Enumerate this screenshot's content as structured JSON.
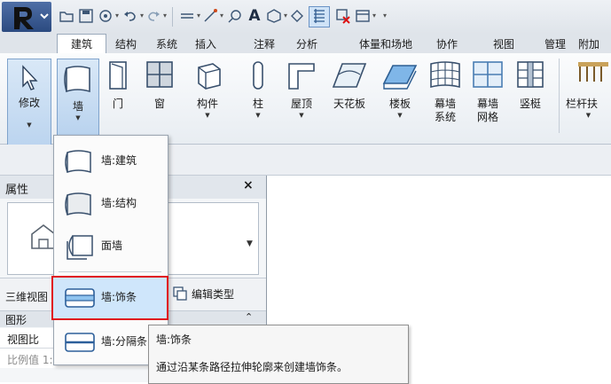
{
  "quick_access": {
    "icons": [
      "open-icon",
      "save-icon",
      "sync-icon",
      "undo-icon",
      "redo-icon",
      "measure-icon",
      "dimension-icon",
      "tag-icon",
      "text-icon",
      "view-3d-icon",
      "section-icon",
      "thin-lines-icon",
      "close-views-icon",
      "switch-windows-icon"
    ]
  },
  "tabs": [
    "建筑",
    "结构",
    "系统",
    "插入",
    "注释",
    "分析",
    "体量和场地",
    "协作",
    "视图",
    "管理",
    "附加"
  ],
  "ribbon": {
    "modify": "修改",
    "wall": "墙",
    "door": "门",
    "window": "窗",
    "component": "构件",
    "column": "柱",
    "roof": "屋顶",
    "ceiling": "天花板",
    "floor": "楼板",
    "curtain_system_1": "幕墙",
    "curtain_system_2": "系统",
    "curtain_grid_1": "幕墙",
    "curtain_grid_2": "网格",
    "mullion": "竖梃",
    "railing": "栏杆扶"
  },
  "properties": {
    "title": "属性",
    "close": "×",
    "view_label": "三维视图",
    "edit_type": "编辑类型",
    "group_graphics": "图形",
    "row_view_scale": "视图比",
    "row_scale_value": "比例值 1:"
  },
  "wall_menu": {
    "items": [
      "墙:建筑",
      "墙:结构",
      "面墙",
      "墙:饰条",
      "墙:分隔条"
    ]
  },
  "tooltip": {
    "title": "墙:饰条",
    "description": "通过沿某条路径拉伸轮廓来创建墙饰条。"
  }
}
